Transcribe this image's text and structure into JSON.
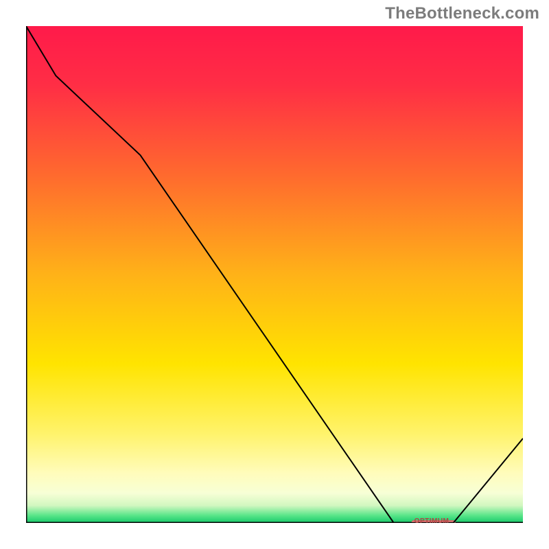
{
  "attribution": "TheBottleneck.com",
  "chart_data": {
    "type": "line",
    "title": "",
    "xlabel": "",
    "ylabel": "",
    "x": [
      0.0,
      0.06,
      0.23,
      0.74,
      0.78,
      0.86,
      1.0
    ],
    "values": [
      1.0,
      0.9,
      0.74,
      0.0,
      0.0,
      0.0,
      0.17
    ],
    "xlim": [
      0,
      1
    ],
    "ylim": [
      0,
      1
    ],
    "marker": {
      "x0": 0.78,
      "x1": 0.86,
      "y": 0.0,
      "label": "OPTIMUM"
    },
    "gradient_stops": [
      {
        "offset": 0.0,
        "color": "#ff1a4a"
      },
      {
        "offset": 0.12,
        "color": "#ff2e45"
      },
      {
        "offset": 0.3,
        "color": "#ff6a2e"
      },
      {
        "offset": 0.5,
        "color": "#ffb218"
      },
      {
        "offset": 0.68,
        "color": "#ffe400"
      },
      {
        "offset": 0.82,
        "color": "#fff36b"
      },
      {
        "offset": 0.9,
        "color": "#fffcbb"
      },
      {
        "offset": 0.94,
        "color": "#f7ffd6"
      },
      {
        "offset": 0.965,
        "color": "#d2f7c0"
      },
      {
        "offset": 0.985,
        "color": "#59e589"
      },
      {
        "offset": 1.0,
        "color": "#17c96a"
      }
    ],
    "axis_color": "#000000",
    "line_color": "#000000",
    "marker_color": "#d16a6a"
  }
}
